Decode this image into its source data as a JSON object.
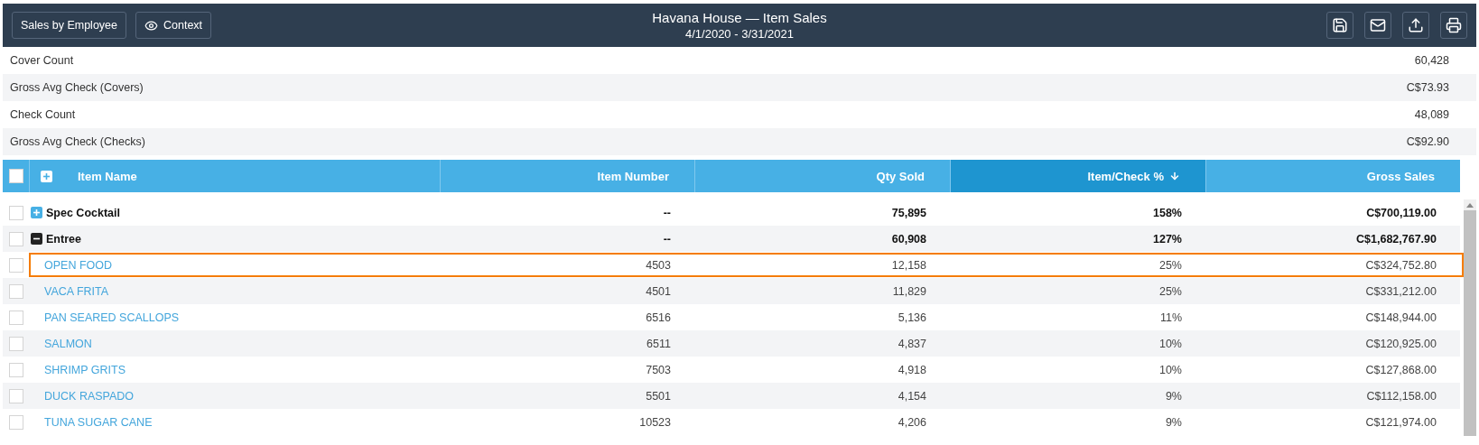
{
  "toolbar": {
    "buttons": [
      {
        "kind": "text",
        "label": "Sales by Employee"
      },
      {
        "kind": "eye",
        "label": "Context"
      }
    ],
    "title": "Havana House — Item Sales",
    "subtitle": "4/1/2020 - 3/31/2021",
    "actions": [
      {
        "kind": "save"
      },
      {
        "kind": "mail"
      },
      {
        "kind": "upload"
      },
      {
        "kind": "print"
      }
    ]
  },
  "summary": [
    {
      "label": "Cover Count",
      "value": "60,428"
    },
    {
      "label": "Gross Avg Check (Covers)",
      "value": "C$73.93"
    },
    {
      "label": "Check Count",
      "value": "48,089"
    },
    {
      "label": "Gross Avg Check (Checks)",
      "value": "C$92.90"
    }
  ],
  "table": {
    "select_all": {
      "checked": false
    },
    "columns": [
      {
        "label": "Item Name",
        "sorted": false
      },
      {
        "label": "Item Number",
        "sorted": false
      },
      {
        "label": "Qty Sold",
        "sorted": false
      },
      {
        "label": "Item/Check %",
        "sorted": true
      },
      {
        "label": "Gross Sales",
        "sorted": false
      }
    ],
    "rows": [
      {
        "kind": "group",
        "expanded": false,
        "checked": false,
        "selected": false,
        "cells": [
          "Spec Cocktail",
          "--",
          "75,895",
          "158%",
          "C$700,119.00"
        ]
      },
      {
        "kind": "group",
        "expanded": true,
        "checked": false,
        "selected": false,
        "cells": [
          "Entree",
          "--",
          "60,908",
          "127%",
          "C$1,682,767.90"
        ]
      },
      {
        "kind": "item",
        "checked": false,
        "selected": true,
        "cells": [
          "OPEN FOOD",
          "4503",
          "12,158",
          "25%",
          "C$324,752.80"
        ]
      },
      {
        "kind": "item",
        "checked": false,
        "selected": false,
        "cells": [
          "VACA FRITA",
          "4501",
          "11,829",
          "25%",
          "C$331,212.00"
        ]
      },
      {
        "kind": "item",
        "checked": false,
        "selected": false,
        "cells": [
          "PAN SEARED SCALLOPS",
          "6516",
          "5,136",
          "11%",
          "C$148,944.00"
        ]
      },
      {
        "kind": "item",
        "checked": false,
        "selected": false,
        "cells": [
          "SALMON",
          "6511",
          "4,837",
          "10%",
          "C$120,925.00"
        ]
      },
      {
        "kind": "item",
        "checked": false,
        "selected": false,
        "cells": [
          "SHRIMP GRITS",
          "7503",
          "4,918",
          "10%",
          "C$127,868.00"
        ]
      },
      {
        "kind": "item",
        "checked": false,
        "selected": false,
        "cells": [
          "DUCK RASPADO",
          "5501",
          "4,154",
          "9%",
          "C$112,158.00"
        ]
      },
      {
        "kind": "item",
        "checked": false,
        "selected": false,
        "cells": [
          "TUNA SUGAR CANE",
          "10523",
          "4,206",
          "9%",
          "C$121,974.00"
        ]
      }
    ]
  }
}
